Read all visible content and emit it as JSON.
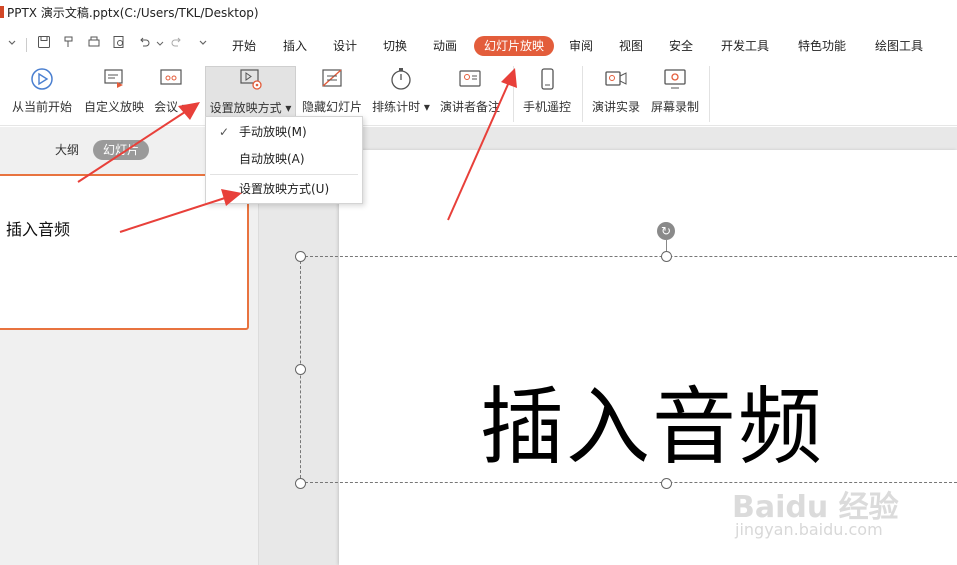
{
  "window": {
    "title": "PPTX 演示文稿.pptx(C:/Users/TKL/Desktop)"
  },
  "menu": {
    "tabs": [
      {
        "label": "开始"
      },
      {
        "label": "插入"
      },
      {
        "label": "设计"
      },
      {
        "label": "切换"
      },
      {
        "label": "动画"
      },
      {
        "label": "幻灯片放映"
      },
      {
        "label": "审阅"
      },
      {
        "label": "视图"
      },
      {
        "label": "安全"
      },
      {
        "label": "开发工具"
      },
      {
        "label": "特色功能"
      },
      {
        "label": "绘图工具"
      }
    ],
    "active_tab": "幻灯片放映"
  },
  "ribbon": {
    "from_current": "从当前开始",
    "custom_show": "自定义放映",
    "meeting": "会议",
    "setup_show": "设置放映方式",
    "hide_slide": "隐藏幻灯片",
    "rehearse": "排练计时",
    "presenter_notes": "演讲者备注",
    "phone_remote": "手机遥控",
    "record_narration": "演讲实录",
    "screen_record": "屏幕录制"
  },
  "dropdown": {
    "items": [
      {
        "label": "手动放映(M)",
        "checked": true
      },
      {
        "label": "自动放映(A)",
        "checked": false
      },
      {
        "label": "设置放映方式(U)",
        "checked": false
      }
    ]
  },
  "pane": {
    "tabs": [
      {
        "label": "大纲"
      },
      {
        "label": "幻灯片"
      }
    ],
    "active_tab": "幻灯片",
    "thumbnail_text": "插入音频"
  },
  "slide": {
    "title": "插入音频"
  },
  "watermark": {
    "brand": "Baidu 经验",
    "url": "jingyan.baidu.com"
  },
  "colors": {
    "accent": "#e35d3b",
    "arrow": "#e8403a",
    "thumbnail_border": "#e8733f"
  }
}
